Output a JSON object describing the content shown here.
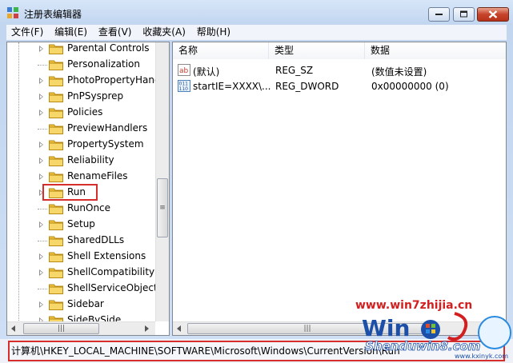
{
  "window": {
    "title": "注册表编辑器"
  },
  "menubar": [
    {
      "label": "文件(F)"
    },
    {
      "label": "编辑(E)"
    },
    {
      "label": "查看(V)"
    },
    {
      "label": "收藏夹(A)"
    },
    {
      "label": "帮助(H)"
    }
  ],
  "tree": {
    "items": [
      {
        "label": "Parental Controls",
        "expandable": true
      },
      {
        "label": "Personalization",
        "expandable": false
      },
      {
        "label": "PhotoPropertyHand",
        "expandable": true
      },
      {
        "label": "PnPSysprep",
        "expandable": true
      },
      {
        "label": "Policies",
        "expandable": true
      },
      {
        "label": "PreviewHandlers",
        "expandable": false
      },
      {
        "label": "PropertySystem",
        "expandable": true
      },
      {
        "label": "Reliability",
        "expandable": true
      },
      {
        "label": "RenameFiles",
        "expandable": true
      },
      {
        "label": "Run",
        "expandable": true,
        "highlighted": true
      },
      {
        "label": "RunOnce",
        "expandable": false
      },
      {
        "label": "Setup",
        "expandable": true
      },
      {
        "label": "SharedDLLs",
        "expandable": false
      },
      {
        "label": "Shell Extensions",
        "expandable": true
      },
      {
        "label": "ShellCompatibility",
        "expandable": true
      },
      {
        "label": "ShellServiceObjectI",
        "expandable": false
      },
      {
        "label": "Sidebar",
        "expandable": true
      },
      {
        "label": "SideBySide",
        "expandable": true
      }
    ]
  },
  "list": {
    "columns": [
      "名称",
      "类型",
      "数据"
    ],
    "rows": [
      {
        "icon": "string-value-icon",
        "name": "(默认)",
        "type": "REG_SZ",
        "data": "(数值未设置)"
      },
      {
        "icon": "binary-value-icon",
        "name": "startIE=XXXX\\...",
        "type": "REG_DWORD",
        "data": "0x00000000 (0)"
      }
    ]
  },
  "statusbar": {
    "path": "计算机\\HKEY_LOCAL_MACHINE\\SOFTWARE\\Microsoft\\Windows\\CurrentVersion\\Run"
  },
  "watermark": {
    "url": "www.win7zhijia.cn",
    "logo_text": "Shenduwin8.com",
    "logo_sub": "www.kxinyk.com"
  },
  "colors": {
    "highlight_box": "#d62d2d",
    "window_frame": "#c9daf1",
    "folder": "#f0c23b"
  }
}
